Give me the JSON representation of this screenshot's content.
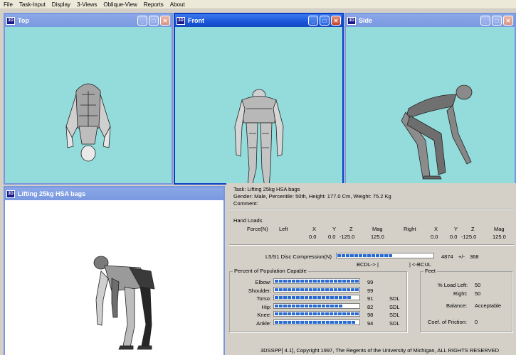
{
  "menu": [
    "File",
    "Task-Input",
    "Display",
    "3-Views",
    "Oblique-View",
    "Reports",
    "About"
  ],
  "windows": {
    "top": {
      "title": "Top",
      "icon": "3D"
    },
    "front": {
      "title": "Front",
      "icon": "3D"
    },
    "side": {
      "title": "Side",
      "icon": "3D"
    },
    "oblique": {
      "title": "Lifting 25kg HSA bags",
      "icon": "3D"
    }
  },
  "report": {
    "task": "Task: Lifting 25kg HSA bags",
    "gender": "Gender: Male, Percentile: 50th, Height: 177.0 Cm, Weight: 75.2 Kg",
    "comment": "Comment:",
    "hand_loads": {
      "title": "Hand Loads",
      "force_label": "Force(N)",
      "left_label": "Left",
      "right_label": "Right",
      "x": "X",
      "y": "Y",
      "z": "Z",
      "mag": "Mag",
      "left_values": {
        "x": "0.0",
        "y": "0.0",
        "z": "-125.0",
        "mag": "125.0"
      },
      "right_values": {
        "x": "0.0",
        "y": "0.0",
        "z": "-125.0",
        "mag": "125.0"
      }
    },
    "disc": {
      "label": "L5/S1 Disc Compression(N)",
      "value": "4874",
      "pm": "+/-",
      "sd": "368",
      "bcdl": "BCDL-> |",
      "bcul": "| <-BCUL",
      "fraction": 0.57
    },
    "population": {
      "title": "Percent of Population Capable",
      "rows": [
        {
          "label": "Elbow:",
          "value": "99",
          "flag": "",
          "fraction": 0.99
        },
        {
          "label": "Shoulder:",
          "value": "99",
          "flag": "",
          "fraction": 0.99
        },
        {
          "label": "Torso:",
          "value": "91",
          "flag": "SDL",
          "fraction": 0.91
        },
        {
          "label": "Hip:",
          "value": "82",
          "flag": "SDL",
          "fraction": 0.82
        },
        {
          "label": "Knee:",
          "value": "98",
          "flag": "SDL",
          "fraction": 0.98
        },
        {
          "label": "Ankle:",
          "value": "94",
          "flag": "SDL",
          "fraction": 0.94
        }
      ]
    },
    "feet": {
      "title": "Feet",
      "load_left_label": "% Load Left:",
      "load_left": "50",
      "right_label": "Right:",
      "right": "50",
      "balance_label": "Balance:",
      "balance": "Acceptable",
      "friction_label": "Coef. of Friction:",
      "friction": "0"
    },
    "copyright": "3DSSPP[ 4.1], Copyright 1997, The Regents of the University of Michigan, ALL RIGHTS RESERVED"
  },
  "colors": {
    "viewport": "#93dcdb",
    "bar": "#2a6bd1",
    "titlebar": "#1a56d9"
  }
}
